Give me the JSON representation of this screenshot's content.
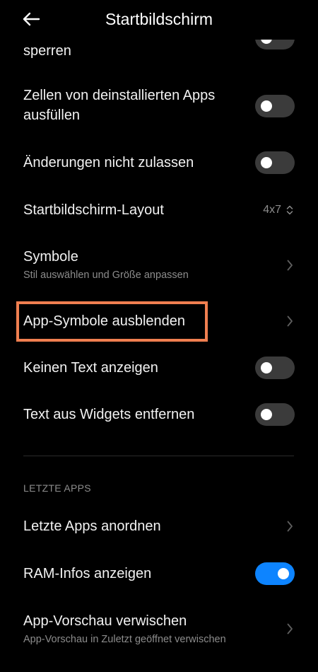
{
  "header": {
    "back_icon": "arrow-left-icon",
    "title": "Startbildschirm"
  },
  "rows": {
    "lock": {
      "label": "sperren",
      "toggle": "off"
    },
    "fill_cells": {
      "label_line1": "Zellen von deinstallierten Apps",
      "label_line2": "ausfüllen",
      "toggle": "off"
    },
    "no_changes": {
      "label": "Änderungen nicht zulassen",
      "toggle": "off"
    },
    "layout": {
      "label": "Startbildschirm-Layout",
      "value": "4x7"
    },
    "icons": {
      "label": "Symbole",
      "subtitle": "Stil auswählen und Größe anpassen"
    },
    "hide_icons": {
      "label": "App-Symbole ausblenden",
      "highlighted": true
    },
    "no_text": {
      "label": "Keinen Text anzeigen",
      "toggle": "off"
    },
    "widget_text": {
      "label": "Text aus Widgets entfernen",
      "toggle": "off"
    }
  },
  "recent_apps": {
    "section_title": "LETZTE APPS",
    "arrange": {
      "label": "Letzte Apps anordnen"
    },
    "ram_info": {
      "label": "RAM-Infos anzeigen",
      "toggle": "on"
    },
    "blur_preview": {
      "label": "App-Vorschau verwischen",
      "subtitle": "App-Vorschau in Zuletzt geöffnet verwischen"
    }
  },
  "colors": {
    "background": "#000000",
    "toggle_on": "#0d84ff",
    "toggle_off": "#3b3b3b",
    "highlight_border": "#f07f50",
    "secondary_text": "#8c8c8c"
  }
}
